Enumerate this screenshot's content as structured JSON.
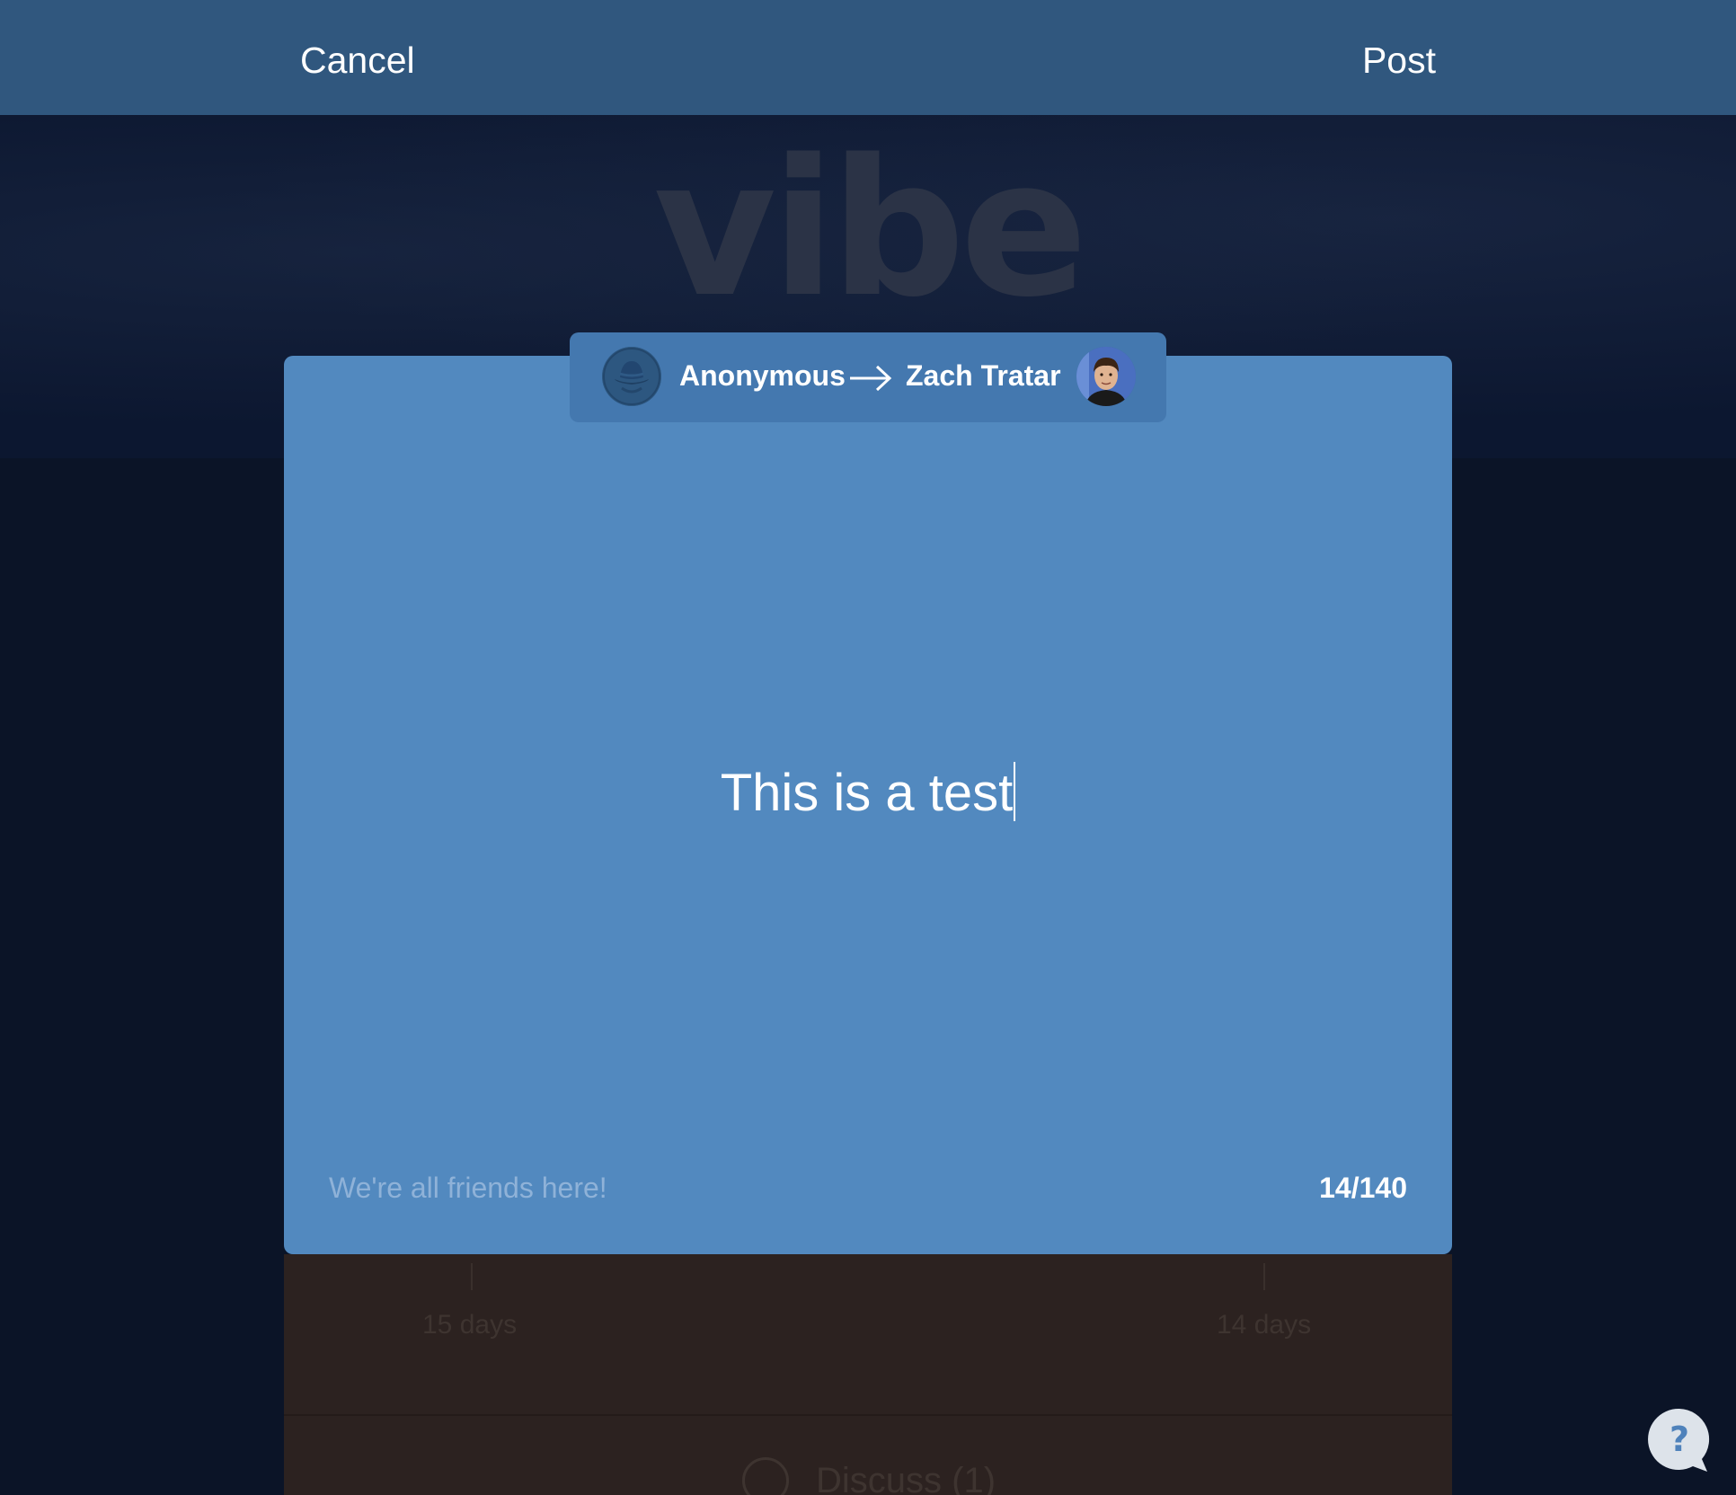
{
  "topbar": {
    "cancel_label": "Cancel",
    "post_label": "Post"
  },
  "background": {
    "logo_text": "vibe",
    "card": {
      "left_days": "15 days",
      "right_days": "14 days",
      "discuss_label": "Discuss (1)"
    }
  },
  "compose": {
    "sender_name": "Anonymous",
    "recipient_name": "Zach Tratar",
    "message_text": "This is a test",
    "hint_text": "We're all friends here!",
    "char_count": "14/140"
  },
  "help": {
    "icon_label": "?"
  },
  "colors": {
    "topbar": "#30577e",
    "card": "#5289bf",
    "header_pill": "#4478af",
    "background": "#0b1427"
  }
}
